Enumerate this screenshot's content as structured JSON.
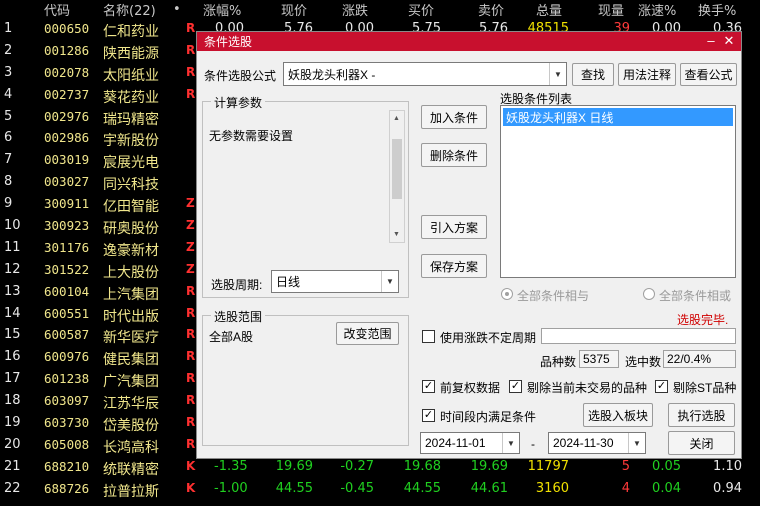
{
  "header": {
    "idx": "",
    "code": "代码",
    "name": "名称(22)",
    "dot": "•",
    "pct": "涨幅%",
    "price": "现价",
    "chg": "涨跌",
    "bid": "买价",
    "ask": "卖价",
    "vol": "总量",
    "cur": "现量",
    "speed": "涨速%",
    "turn": "换手%"
  },
  "rows": [
    {
      "idx": "1",
      "code": "000650",
      "name": "仁和药业",
      "mk": "R",
      "pct": "0.00",
      "price": "5.76",
      "chg": "0.00",
      "bid": "5.75",
      "ask": "5.76",
      "vol": "48515",
      "cur": "39",
      "speed": "0.00",
      "turn": "0.36",
      "pc": "wht"
    },
    {
      "idx": "2",
      "code": "001286",
      "name": "陕西能源",
      "mk": "R",
      "pct": "",
      "price": "",
      "chg": "",
      "bid": "",
      "ask": "",
      "vol": "",
      "cur": "",
      "speed": "",
      "turn": "",
      "pc": "wht"
    },
    {
      "idx": "3",
      "code": "002078",
      "name": "太阳纸业",
      "mk": "R",
      "pct": "",
      "price": "",
      "chg": "",
      "bid": "",
      "ask": "",
      "vol": "",
      "cur": "",
      "speed": "",
      "turn": "",
      "pc": "wht"
    },
    {
      "idx": "4",
      "code": "002737",
      "name": "葵花药业",
      "mk": "R",
      "pct": "",
      "price": "",
      "chg": "",
      "bid": "",
      "ask": "",
      "vol": "",
      "cur": "",
      "speed": "",
      "turn": "",
      "pc": "wht"
    },
    {
      "idx": "5",
      "code": "002976",
      "name": "瑞玛精密",
      "mk": "",
      "pct": "",
      "price": "",
      "chg": "",
      "bid": "",
      "ask": "",
      "vol": "",
      "cur": "",
      "speed": "",
      "turn": "",
      "pc": "wht"
    },
    {
      "idx": "6",
      "code": "002986",
      "name": "宇新股份",
      "mk": "",
      "pct": "",
      "price": "",
      "chg": "",
      "bid": "",
      "ask": "",
      "vol": "",
      "cur": "",
      "speed": "",
      "turn": "",
      "pc": "wht"
    },
    {
      "idx": "7",
      "code": "003019",
      "name": "宸展光电",
      "mk": "",
      "pct": "",
      "price": "",
      "chg": "",
      "bid": "",
      "ask": "",
      "vol": "",
      "cur": "",
      "speed": "",
      "turn": "",
      "pc": "wht"
    },
    {
      "idx": "8",
      "code": "003027",
      "name": "同兴科技",
      "mk": "",
      "pct": "",
      "price": "",
      "chg": "",
      "bid": "",
      "ask": "",
      "vol": "",
      "cur": "",
      "speed": "",
      "turn": "",
      "pc": "wht"
    },
    {
      "idx": "9",
      "code": "300911",
      "name": "亿田智能",
      "mk": "Z",
      "pct": "",
      "price": "",
      "chg": "",
      "bid": "",
      "ask": "",
      "vol": "",
      "cur": "",
      "speed": "",
      "turn": "",
      "pc": "wht"
    },
    {
      "idx": "10",
      "code": "300923",
      "name": "研奥股份",
      "mk": "Z",
      "pct": "",
      "price": "",
      "chg": "",
      "bid": "",
      "ask": "",
      "vol": "",
      "cur": "",
      "speed": "",
      "turn": "",
      "pc": "wht"
    },
    {
      "idx": "11",
      "code": "301176",
      "name": "逸豪新材",
      "mk": "Z",
      "pct": "",
      "price": "",
      "chg": "",
      "bid": "",
      "ask": "",
      "vol": "",
      "cur": "",
      "speed": "",
      "turn": "",
      "pc": "wht"
    },
    {
      "idx": "12",
      "code": "301522",
      "name": "上大股份",
      "mk": "Z",
      "pct": "",
      "price": "",
      "chg": "",
      "bid": "",
      "ask": "",
      "vol": "",
      "cur": "",
      "speed": "",
      "turn": "",
      "pc": "wht"
    },
    {
      "idx": "13",
      "code": "600104",
      "name": "上汽集团",
      "mk": "R",
      "pct": "",
      "price": "",
      "chg": "",
      "bid": "",
      "ask": "",
      "vol": "",
      "cur": "",
      "speed": "",
      "turn": "",
      "pc": "wht"
    },
    {
      "idx": "14",
      "code": "600551",
      "name": "时代出版",
      "mk": "R",
      "pct": "",
      "price": "",
      "chg": "",
      "bid": "",
      "ask": "",
      "vol": "",
      "cur": "",
      "speed": "",
      "turn": "",
      "pc": "wht"
    },
    {
      "idx": "15",
      "code": "600587",
      "name": "新华医疗",
      "mk": "R",
      "pct": "",
      "price": "",
      "chg": "",
      "bid": "",
      "ask": "",
      "vol": "",
      "cur": "",
      "speed": "",
      "turn": "",
      "pc": "wht"
    },
    {
      "idx": "16",
      "code": "600976",
      "name": "健民集团",
      "mk": "R",
      "pct": "",
      "price": "",
      "chg": "",
      "bid": "",
      "ask": "",
      "vol": "",
      "cur": "",
      "speed": "",
      "turn": "",
      "pc": "wht"
    },
    {
      "idx": "17",
      "code": "601238",
      "name": "广汽集团",
      "mk": "R",
      "pct": "",
      "price": "",
      "chg": "",
      "bid": "",
      "ask": "",
      "vol": "",
      "cur": "",
      "speed": "",
      "turn": "",
      "pc": "wht"
    },
    {
      "idx": "18",
      "code": "603097",
      "name": "江苏华辰",
      "mk": "R",
      "pct": "",
      "price": "",
      "chg": "",
      "bid": "",
      "ask": "",
      "vol": "",
      "cur": "",
      "speed": "",
      "turn": "",
      "pc": "wht"
    },
    {
      "idx": "19",
      "code": "603730",
      "name": "岱美股份",
      "mk": "R",
      "pct": "",
      "price": "",
      "chg": "",
      "bid": "",
      "ask": "",
      "vol": "",
      "cur": "",
      "speed": "",
      "turn": "",
      "pc": "wht"
    },
    {
      "idx": "20",
      "code": "605008",
      "name": "长鸿高科",
      "mk": "R",
      "pct": "",
      "price": "",
      "chg": "",
      "bid": "",
      "ask": "",
      "vol": "",
      "cur": "",
      "speed": "",
      "turn": "",
      "pc": "wht"
    },
    {
      "idx": "21",
      "code": "688210",
      "name": "统联精密",
      "mk": "K",
      "pct": "-1.35",
      "price": "19.69",
      "chg": "-0.27",
      "bid": "19.68",
      "ask": "19.69",
      "vol": "11797",
      "cur": "5",
      "speed": "0.05",
      "turn": "1.10",
      "pc": "grn"
    },
    {
      "idx": "22",
      "code": "688726",
      "name": "拉普拉斯",
      "mk": "K",
      "pct": "-1.00",
      "price": "44.55",
      "chg": "-0.45",
      "bid": "44.55",
      "ask": "44.61",
      "vol": "3160",
      "cur": "4",
      "speed": "0.04",
      "turn": "0.94",
      "pc": "grn"
    }
  ],
  "dialog": {
    "title": "条件选股",
    "formula_label": "条件选股公式",
    "formula_value": "妖股龙头利器X -",
    "find_btn": "查找",
    "usage_btn": "用法注释",
    "view_btn": "查看公式",
    "calc_group": "计算参数",
    "calc_text": "无参数需要设置",
    "period_label": "选股周期:",
    "period_value": "日线",
    "add_btn": "加入条件",
    "del_btn": "删除条件",
    "import_btn": "引入方案",
    "save_btn": "保存方案",
    "list_label": "选股条件列表",
    "list_item": "妖股龙头利器X  日线",
    "radio_and": "全部条件相与",
    "radio_or": "全部条件相或",
    "status": "选股完毕.",
    "range_group": "选股范围",
    "range_value": "全部A股",
    "range_btn": "改变范围",
    "use_period": "使用涨跌不定周期",
    "count_label": "品种数",
    "count_value": "5375",
    "hit_label": "选中数",
    "hit_value": "22/0.4%",
    "chk_fq": "前复权数据",
    "chk_remove_halt": "剔除当前未交易的品种",
    "chk_remove_st": "剔除ST品种",
    "chk_time": "时间段内满足条件",
    "to_block_btn": "选股入板块",
    "exec_btn": "执行选股",
    "date_from": "2024-11-01",
    "date_sep": "-",
    "date_to": "2024-11-30",
    "close_btn": "关闭"
  },
  "colors": {
    "title_bar": "#c8102e",
    "select_bg": "#3399ff",
    "status_red": "#d00000",
    "code_yellow": "#f0e68c"
  }
}
